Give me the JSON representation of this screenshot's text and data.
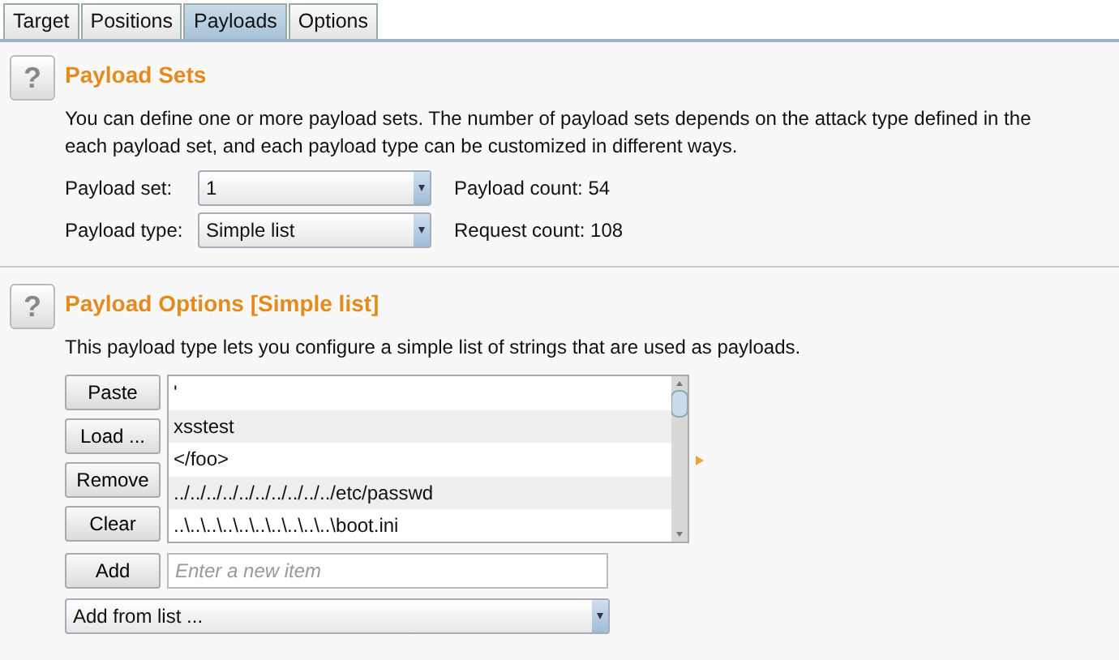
{
  "tabs": [
    {
      "label": "Target",
      "selected": false
    },
    {
      "label": "Positions",
      "selected": false
    },
    {
      "label": "Payloads",
      "selected": true
    },
    {
      "label": "Options",
      "selected": false
    }
  ],
  "payload_sets": {
    "help": "?",
    "title": "Payload Sets",
    "description_lines": [
      "You can define one or more payload sets. The number of payload sets depends on the attack type defined in the",
      "each payload set, and each payload type can be customized in different ways."
    ],
    "fields": [
      {
        "label": "Payload set:",
        "value": "1",
        "info": "Payload count: 54"
      },
      {
        "label": "Payload type:",
        "value": "Simple list",
        "info": "Request count: 108"
      }
    ]
  },
  "payload_options": {
    "help": "?",
    "title": "Payload Options [Simple list]",
    "description": "This payload type lets you configure a simple list of strings that are used as payloads.",
    "buttons": [
      "Paste",
      "Load ...",
      "Remove",
      "Clear"
    ],
    "items": [
      "'",
      "xsstest",
      "</foo>",
      "../../../../../../../../../../etc/passwd",
      "..\\..\\..\\..\\..\\..\\..\\..\\..\\..\\boot.ini"
    ],
    "add_button": "Add",
    "new_item": {
      "placeholder": "Enter a new item"
    },
    "add_from_list": "Add from list ..."
  }
}
